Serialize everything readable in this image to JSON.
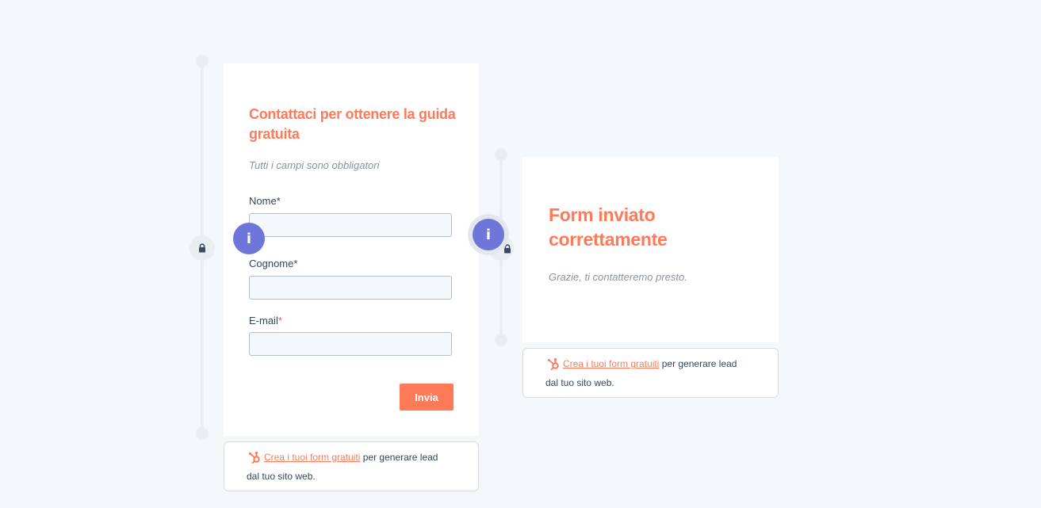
{
  "form": {
    "title_line1": "Contattaci per ottenere la guida",
    "title_line2": "gratuita",
    "required_note": "Tutti i campi sono obbligatori",
    "fields": [
      {
        "label": "Nome",
        "required_mark": "*"
      },
      {
        "label": "Cognome",
        "required_mark": "*"
      },
      {
        "label": "E-mail",
        "required_mark": "*"
      }
    ],
    "submit_label": "Invia"
  },
  "confirmation": {
    "title_line1": "Form inviato",
    "title_line2": "correttamente",
    "message": "Grazie, ti contatteremo presto."
  },
  "footer": {
    "link_text": "Crea i tuoi form gratuiti",
    "text_after_link": " per generare lead",
    "line2": "dal tuo sito web."
  },
  "badges": {
    "info_glyph": "i",
    "icons": [
      "lock-icon",
      "info-icon",
      "hubspot-sprocket-icon"
    ]
  },
  "colors": {
    "accent": "#ff7a59",
    "info": "#6f76d9",
    "text": "#33475b",
    "background": "#f5f8fa"
  }
}
